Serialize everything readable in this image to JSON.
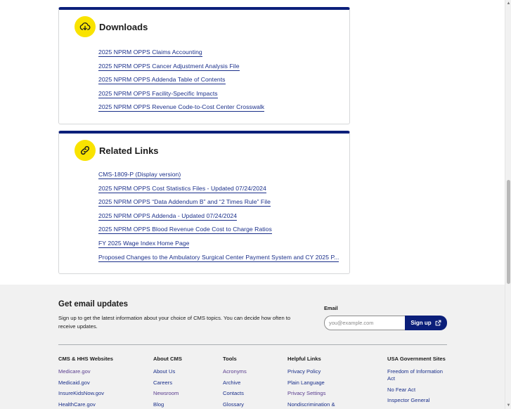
{
  "downloads": {
    "title": "Downloads",
    "icon": "cloud-download-icon",
    "links": [
      "2025 NPRM OPPS Claims Accounting",
      "2025 NPRM OPPS Cancer Adjustment Analysis File",
      "2025 NPRM OPPS Addenda Table of Contents",
      "2025 NPRM OPPS Facility-Specific Impacts",
      "2025 NPRM OPPS Revenue Code-to-Cost Center Crosswalk"
    ]
  },
  "related": {
    "title": "Related Links",
    "icon": "link-icon",
    "links": [
      "CMS-1809-P (Display version)",
      "2025 NPRM OPPS Cost Statistics Files - Updated 07/24/2024",
      "2025 NPRM OPPS “Data Addendum B” and “2 Times Rule” File",
      "2025 NPRM OPPS Addenda - Updated 07/24/2024",
      "2025 NPRM OPPS Blood Revenue Code Cost to Charge Ratios",
      "FY 2025 Wage Index Home Page",
      "Proposed Changes to the Ambulatory Surgical Center Payment System and CY 2025 P..."
    ]
  },
  "email": {
    "heading": "Get email updates",
    "description": "Sign up to get the latest information about your choice of CMS topics. You can decide how often to receive updates.",
    "label": "Email",
    "placeholder": "you@example.com",
    "button": "Sign up"
  },
  "footer": {
    "columns": [
      {
        "heading": "CMS & HHS Websites",
        "items": [
          "Medicare.gov",
          "Medicaid.gov",
          "InsureKidsNow.gov",
          "HealthCare.gov"
        ]
      },
      {
        "heading": "About CMS",
        "items": [
          "About Us",
          "Careers",
          "Newsroom",
          "Blog"
        ]
      },
      {
        "heading": "Tools",
        "items": [
          "Acronyms",
          "Archive",
          "Contacts",
          "Glossary"
        ]
      },
      {
        "heading": "Helpful Links",
        "items": [
          "Privacy Policy",
          "Plain Language",
          "Privacy Settings",
          "Nondiscrimination &"
        ]
      },
      {
        "heading": "USA Government Sites",
        "items": [
          "Freedom of Information Act",
          "No Fear Act",
          "Inspector General"
        ]
      }
    ]
  },
  "colors": {
    "accent_blue": "#0b1f7a",
    "icon_yellow": "#f9e300",
    "link_blue": "#1a2f8a",
    "visited_purple": "#5a3d8f",
    "footer_bg": "#f1f1f1"
  }
}
